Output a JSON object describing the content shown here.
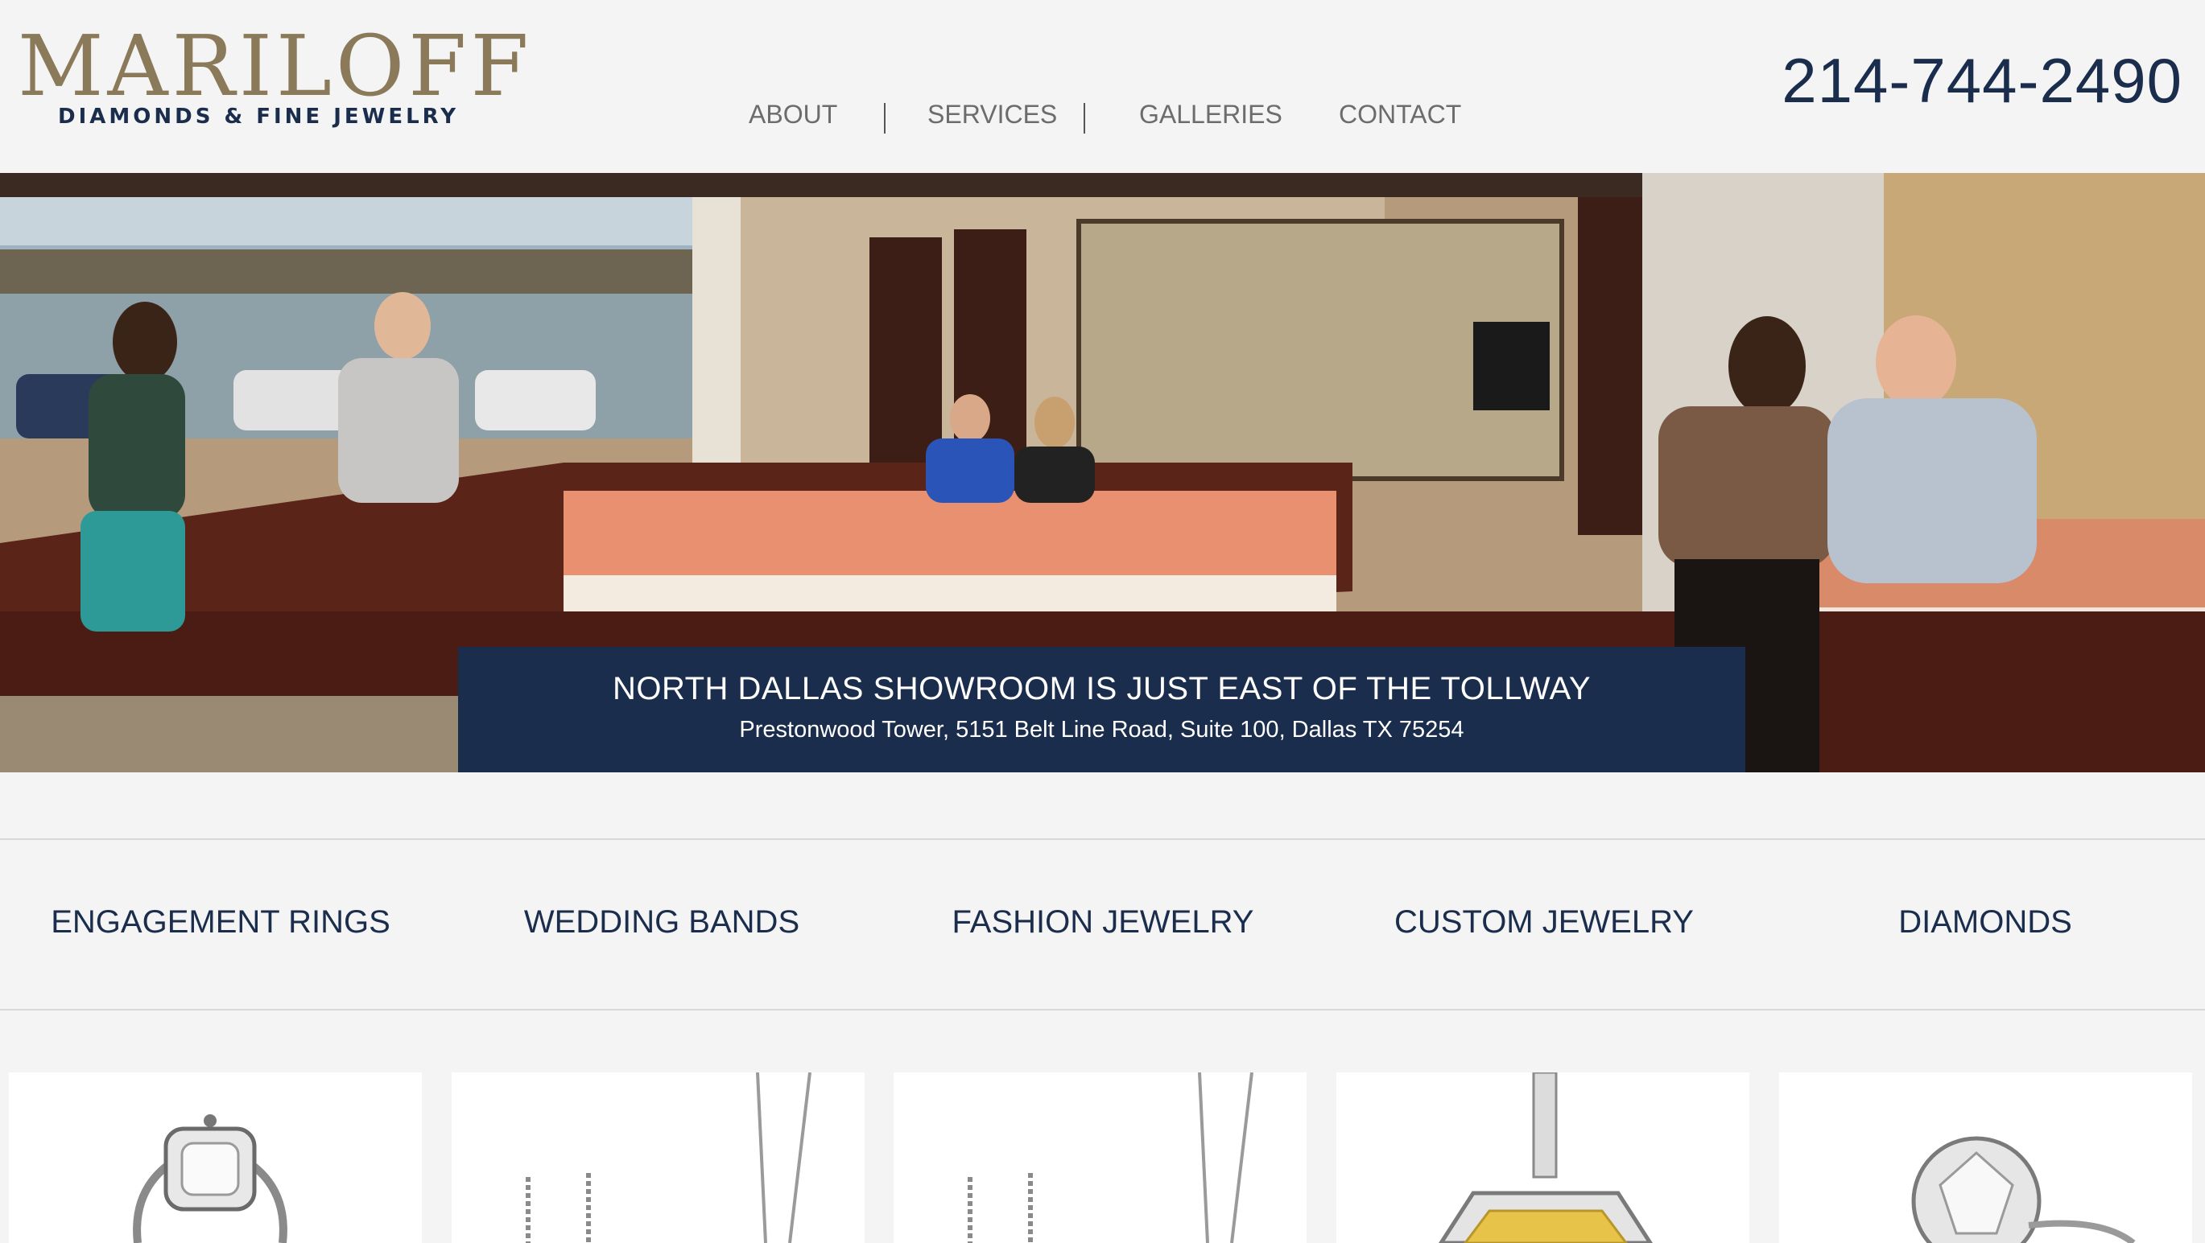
{
  "brand": {
    "name": "MARILOFF",
    "tagline": "DIAMONDS & FINE JEWELRY",
    "colors": {
      "navy": "#1b2d4c",
      "gold": "#8a7a5a",
      "nav_gray": "#6c6c6c"
    }
  },
  "nav": {
    "items": [
      {
        "label": "ABOUT"
      },
      {
        "label": "SERVICES"
      },
      {
        "label": "GALLERIES"
      },
      {
        "label": "CONTACT"
      }
    ]
  },
  "phone": "214-744-2490",
  "hero": {
    "image": "jewelry-showroom-photo",
    "banner_title": "NORTH DALLAS SHOWROOM IS JUST EAST OF THE TOLLWAY",
    "banner_address": "Prestonwood Tower, 5151 Belt Line Road, Suite 100, Dallas TX 75254"
  },
  "categories": [
    {
      "label": "ENGAGEMENT RINGS"
    },
    {
      "label": "WEDDING BANDS"
    },
    {
      "label": "FASHION JEWELRY"
    },
    {
      "label": "CUSTOM JEWELRY"
    },
    {
      "label": "DIAMONDS"
    }
  ],
  "products": [
    {
      "image": "cushion-halo-ring-icon"
    },
    {
      "image": "diamond-pendant-necklace-icon"
    },
    {
      "image": "diamond-pendant-necklace-icon"
    },
    {
      "image": "yellow-diamond-pendant-icon"
    },
    {
      "image": "solitaire-ring-icon"
    }
  ]
}
